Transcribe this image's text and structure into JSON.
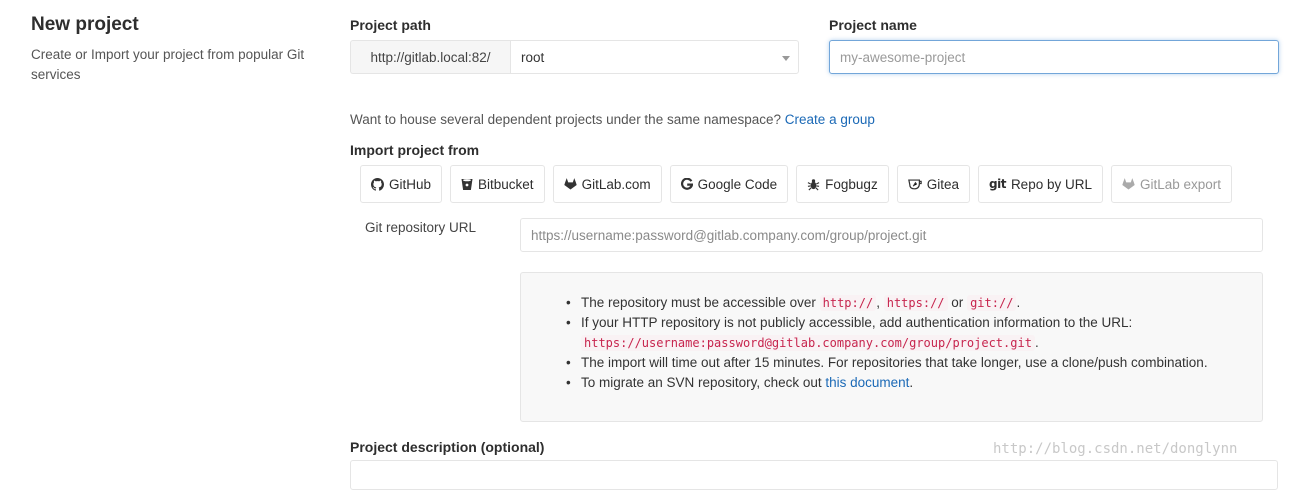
{
  "header": {
    "title": "New project",
    "subtitle": "Create or Import your project from popular Git services"
  },
  "project_path": {
    "label": "Project path",
    "prefix": "http://gitlab.local:82/",
    "namespace": "root"
  },
  "project_name": {
    "label": "Project name",
    "placeholder": "my-awesome-project"
  },
  "group_hint": {
    "text": "Want to house several dependent projects under the same namespace?",
    "link": "Create a group"
  },
  "import": {
    "label": "Import project from",
    "buttons": [
      {
        "label": "GitHub",
        "icon": "github-icon"
      },
      {
        "label": "Bitbucket",
        "icon": "bitbucket-icon"
      },
      {
        "label": "GitLab.com",
        "icon": "gitlab-icon"
      },
      {
        "label": "Google Code",
        "icon": "google-icon"
      },
      {
        "label": "Fogbugz",
        "icon": "bug-icon"
      },
      {
        "label": "Gitea",
        "icon": "gitea-icon"
      },
      {
        "label": "Repo by URL",
        "icon": "git-icon",
        "icon_text": "git"
      },
      {
        "label": "GitLab export",
        "icon": "gitlab-icon",
        "disabled": true
      }
    ]
  },
  "git_url": {
    "label": "Git repository URL",
    "placeholder": "https://username:password@gitlab.company.com/group/project.git"
  },
  "info": {
    "item1": {
      "text": "The repository must be accessible over",
      "code1": "http://",
      "sep": ",",
      "code2": "https://",
      "or": "or",
      "code3": "git://",
      "end": "."
    },
    "item2": {
      "text": "If your HTTP repository is not publicly accessible, add authentication information to the URL:",
      "code": "https://username:password@gitlab.company.com/group/project.git",
      "end": "."
    },
    "item3": {
      "text": "The import will time out after 15 minutes. For repositories that take longer, use a clone/push combination."
    },
    "item4": {
      "text": "To migrate an SVN repository, check out",
      "link": "this document",
      "end": "."
    }
  },
  "description": {
    "label": "Project description (optional)"
  },
  "watermark": "http://blog.csdn.net/donglynn",
  "colors": {
    "link": "#1b69b6",
    "code": "#c7254e",
    "focus_border": "#73a6d9"
  }
}
